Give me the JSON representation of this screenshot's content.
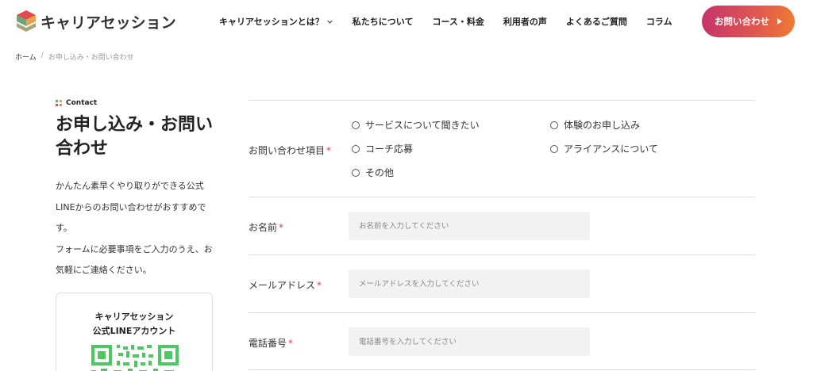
{
  "header": {
    "logo_text": "キャリアセッション",
    "nav": [
      {
        "label": "キャリアセッションとは？",
        "has_dropdown": true
      },
      {
        "label": "私たちについて"
      },
      {
        "label": "コース・料金"
      },
      {
        "label": "利用者の声"
      },
      {
        "label": "よくあるご質問"
      },
      {
        "label": "コラム"
      }
    ],
    "cta_label": "お問い合わせ"
  },
  "breadcrumb": {
    "home": "ホーム",
    "separator": "/",
    "current": "お申し込み・お問い合わせ"
  },
  "section": {
    "tag": "Contact",
    "title": "お申し込み・お問い合わせ",
    "intro": [
      "かんたん素早くやり取りができる公式LINEからのお問い合わせがおすすめです。",
      "フォームに必要事項をご入力のうえ、お気軽にご連絡ください。"
    ]
  },
  "line_card": {
    "title_line1": "キャリアセッション",
    "title_line2": "公式LINEアカウント"
  },
  "form": {
    "required_mark": "*",
    "inquiry": {
      "label": "お問い合わせ項目",
      "options": [
        "サービスについて聞きたい",
        "体験のお申し込み",
        "コーチ応募",
        "アライアンスについて",
        "その他"
      ]
    },
    "name": {
      "label": "お名前",
      "placeholder": "お名前を入力してください"
    },
    "email": {
      "label": "メールアドレス",
      "placeholder": "メールアドレスを入力してください"
    },
    "phone": {
      "label": "電話番号",
      "placeholder": "電話番号を入力してください"
    }
  },
  "colors": {
    "accent_gradient_start": "#c4356a",
    "accent_gradient_end": "#ef7a32",
    "required": "#d23c5a",
    "line_green": "#4cc764",
    "input_bg": "#f2f2f2"
  }
}
